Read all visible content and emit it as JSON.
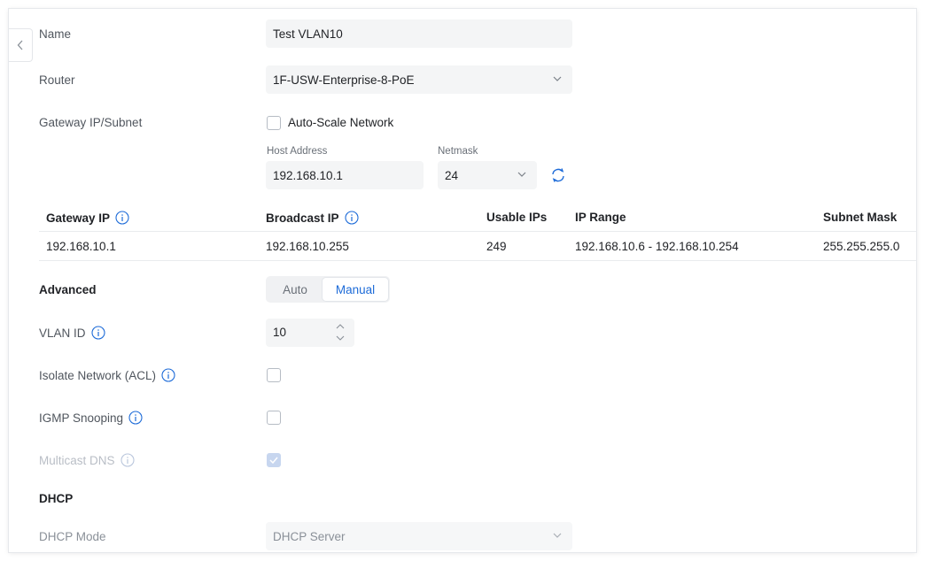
{
  "form": {
    "name": {
      "label": "Name",
      "value": "Test VLAN10"
    },
    "router": {
      "label": "Router",
      "value": "1F-USW-Enterprise-8-PoE"
    },
    "gateway": {
      "label": "Gateway IP/Subnet",
      "auto_scale_label": "Auto-Scale Network",
      "host_address_label": "Host Address",
      "host_address_value": "192.168.10.1",
      "netmask_label": "Netmask",
      "netmask_value": "24"
    },
    "summary_table": {
      "headers": [
        "Gateway IP",
        "Broadcast IP",
        "Usable IPs",
        "IP Range",
        "Subnet Mask"
      ],
      "row": [
        "192.168.10.1",
        "192.168.10.255",
        "249",
        "192.168.10.6 - 192.168.10.254",
        "255.255.255.0"
      ]
    },
    "advanced": {
      "label": "Advanced",
      "options": [
        "Auto",
        "Manual"
      ],
      "selected": "Manual"
    },
    "vlan_id": {
      "label": "VLAN ID",
      "value": "10"
    },
    "isolate_network": {
      "label": "Isolate Network (ACL)",
      "checked": false
    },
    "igmp_snooping": {
      "label": "IGMP Snooping",
      "checked": false
    },
    "multicast_dns": {
      "label": "Multicast DNS",
      "checked": true,
      "disabled": true
    },
    "dhcp": {
      "section_label": "DHCP",
      "mode_label": "DHCP Mode",
      "mode_value": "DHCP Server"
    }
  },
  "colors": {
    "accent": "#1d6bd8",
    "field_bg": "#f4f5f6",
    "label_text": "#50565e"
  },
  "icons": {
    "back": "chevron-left-icon",
    "info": "info-circle-icon",
    "select": "chevron-down-icon",
    "refresh": "refresh-icon"
  }
}
